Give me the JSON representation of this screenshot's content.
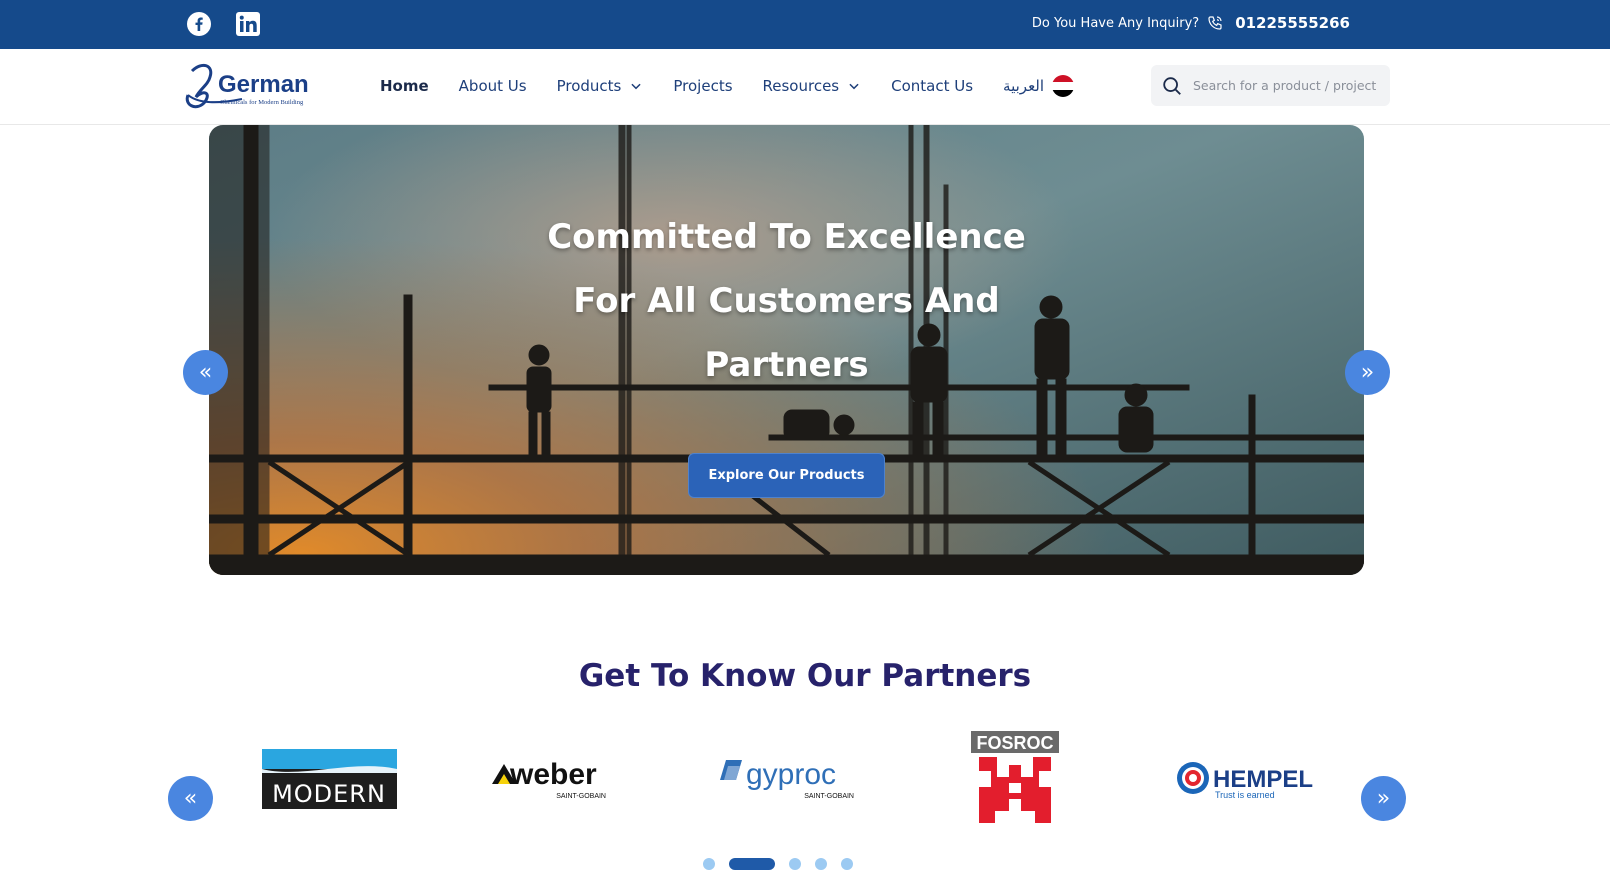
{
  "topbar": {
    "social": [
      {
        "name": "facebook-icon"
      },
      {
        "name": "linkedin-icon"
      }
    ],
    "inquiry_label": "Do You Have Any Inquiry?",
    "phone": "01225555266"
  },
  "navbar": {
    "logo_text": "German",
    "logo_tagline": "Chemicals for Modern Building",
    "items": [
      {
        "label": "Home",
        "active": true
      },
      {
        "label": "About Us"
      },
      {
        "label": "Products",
        "has_dropdown": true
      },
      {
        "label": "Projects"
      },
      {
        "label": "Resources",
        "has_dropdown": true
      },
      {
        "label": "Contact Us"
      },
      {
        "label": "العربية"
      }
    ],
    "search_placeholder": "Search for a product / project"
  },
  "hero": {
    "title_line1": "Committed To Excellence",
    "title_line2": "For All Customers And",
    "title_line3": "Partners",
    "button_label": "Explore Our Products",
    "prev_label": "«",
    "next_label": "»"
  },
  "partners": {
    "title": "Get To Know Our Partners",
    "logos": [
      {
        "name": "MODERN"
      },
      {
        "name": "weber",
        "sub": "SAINT-GOBAIN"
      },
      {
        "name": "gyproc",
        "sub": "SAINT-GOBAIN"
      },
      {
        "name": "FOSROC"
      },
      {
        "name": "HEMPEL",
        "sub": "Trust is earned"
      }
    ],
    "prev_label": "«",
    "next_label": "»",
    "dots": 5,
    "active_dot": 1
  },
  "colors": {
    "topbar": "#154a8b",
    "accent": "#2b63b8",
    "arrow": "#4a86e0",
    "title": "#27226b"
  }
}
